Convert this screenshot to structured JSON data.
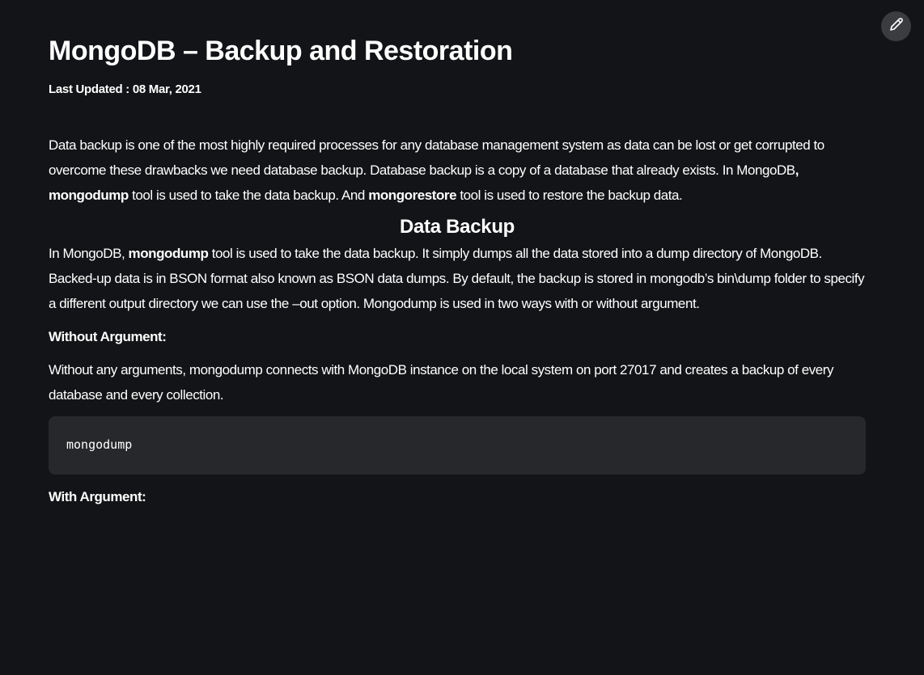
{
  "article": {
    "title": "MongoDB – Backup and Restoration",
    "last_updated": "Last Updated : 08 Mar, 2021",
    "intro": {
      "t1": "Data backup is one of the most highly required processes for any database management system as data can be lost or get corrupted to overcome these drawbacks we need database backup. Database backup is a copy of a database that already exists. In MongoDB",
      "b1": ", mongodump",
      "t2": " tool is used to take the data backup. And ",
      "b2": "mongorestore",
      "t3": " tool is used to restore the backup data."
    },
    "section_heading": "Data Backup",
    "section_para": {
      "t1": "In MongoDB, ",
      "b1": "mongodump",
      "t2": " tool is used to take the data backup. It simply dumps all the data stored into a dump directory of MongoDB. Backed-up data is in BSON format also known as BSON data dumps. By default, the backup is stored in mongodb’s bin\\dump folder to specify a different output directory we can use the –out option. Mongodump is used in two ways with or without argument."
    },
    "without_arg_label": "Without Argument:",
    "without_arg_text": "Without any arguments, mongodump connects with MongoDB instance on the local system on port 27017 and creates a backup of every database and every collection.",
    "code": "mongodump",
    "with_arg_label": "With Argument:"
  },
  "icons": {
    "edit": "pencil-icon"
  }
}
